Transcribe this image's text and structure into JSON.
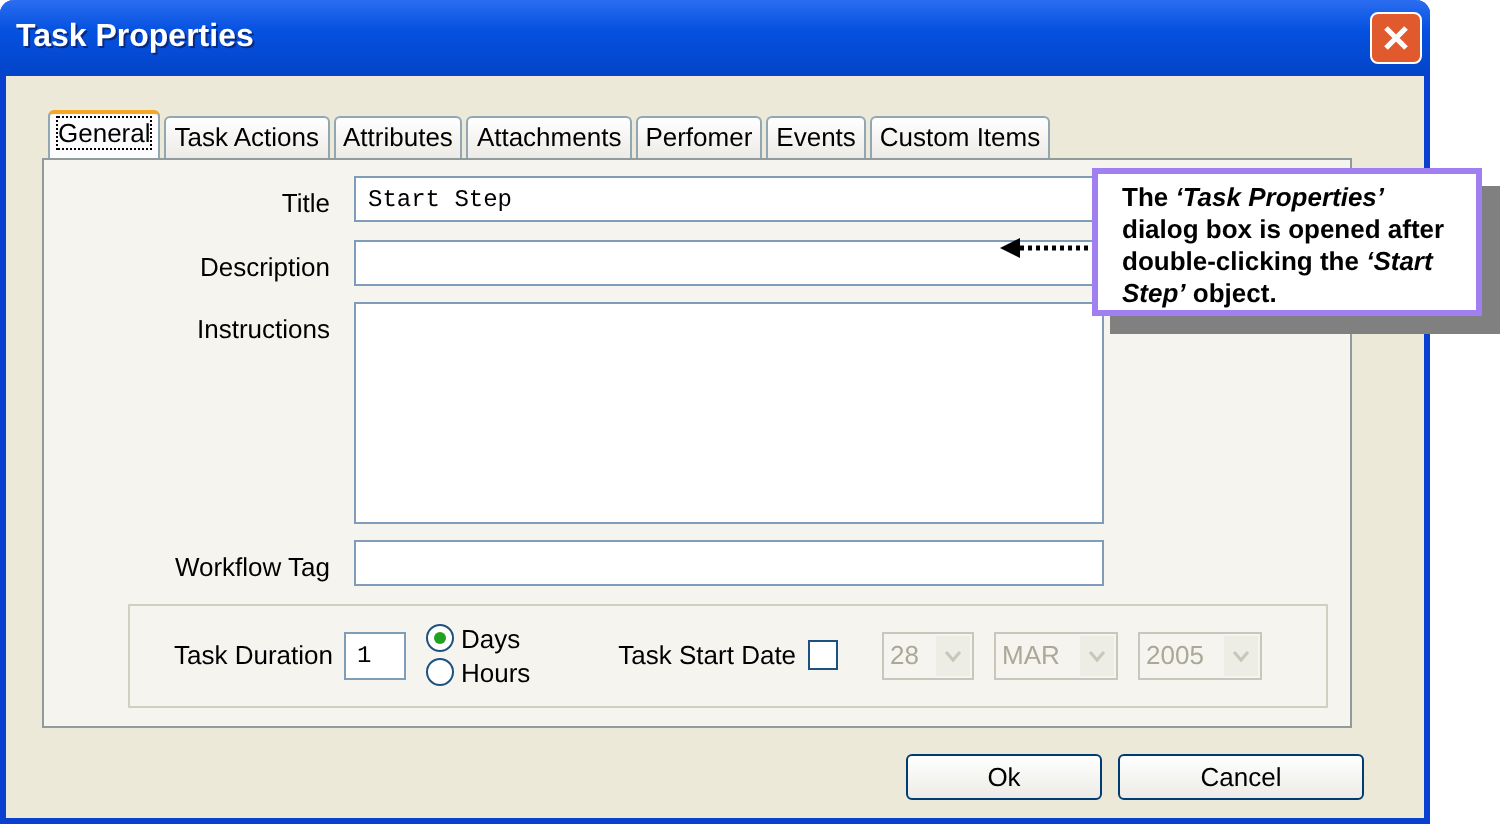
{
  "window": {
    "title": "Task Properties"
  },
  "tabs": [
    {
      "label": "General",
      "selected": true
    },
    {
      "label": "Task Actions",
      "selected": false
    },
    {
      "label": "Attributes",
      "selected": false
    },
    {
      "label": "Attachments",
      "selected": false
    },
    {
      "label": "Perfomer",
      "selected": false
    },
    {
      "label": "Events",
      "selected": false
    },
    {
      "label": "Custom Items",
      "selected": false
    }
  ],
  "fields": [
    {
      "label": "Title",
      "kind": "text",
      "value": "Start Step"
    },
    {
      "label": "Description",
      "kind": "text"
    },
    {
      "label": "Instructions",
      "kind": "textarea"
    },
    {
      "label": "Workflow Tag",
      "kind": "text"
    }
  ],
  "duration": {
    "label": "Task Duration",
    "value": "1",
    "options": [
      {
        "label": "Days",
        "selected": true
      },
      {
        "label": "Hours",
        "selected": false
      }
    ]
  },
  "start_date": {
    "label": "Task Start Date",
    "checked": false,
    "selects": [
      {
        "value": "28",
        "disabled": true
      },
      {
        "value": "MAR",
        "disabled": true
      },
      {
        "value": "2005",
        "disabled": true
      }
    ]
  },
  "buttons": [
    "Ok",
    "Cancel"
  ],
  "callout": {
    "text": "The *‘Task Properties’* dialog box is opened after double-clicking the *‘Start Step’* object."
  }
}
